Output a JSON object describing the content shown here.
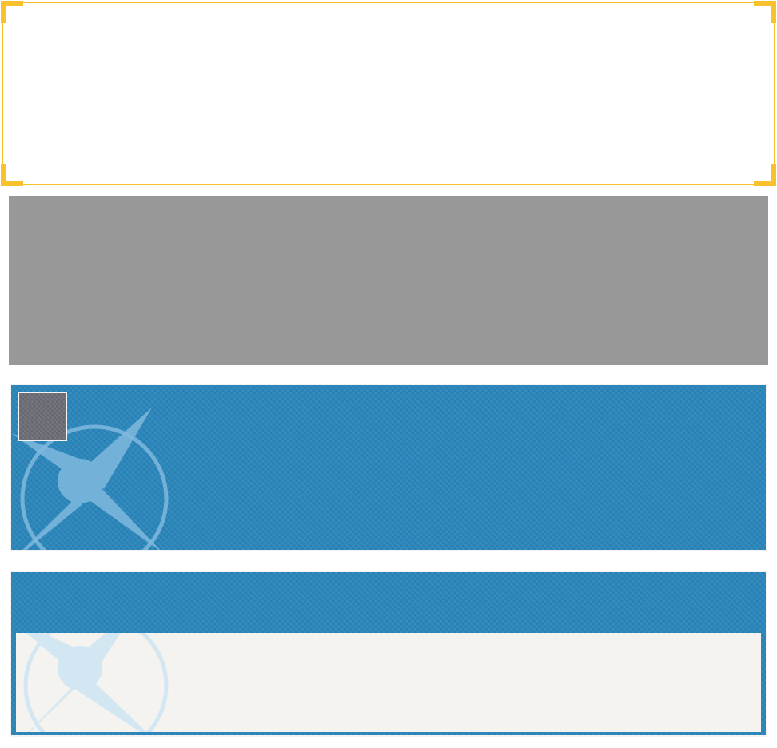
{
  "top_frame": {
    "accent_color": "#f9c12c"
  },
  "placeholder_block": {
    "color": "#989898"
  },
  "banner_panel": {
    "background_color": "#2a86bb",
    "emblem_icon": "compass-star-icon",
    "thumbnail_color": "#6d6d77"
  },
  "content_panel": {
    "background_color": "#2a86bb",
    "card_color": "#f4f3f0",
    "emblem_icon": "compass-star-icon"
  }
}
